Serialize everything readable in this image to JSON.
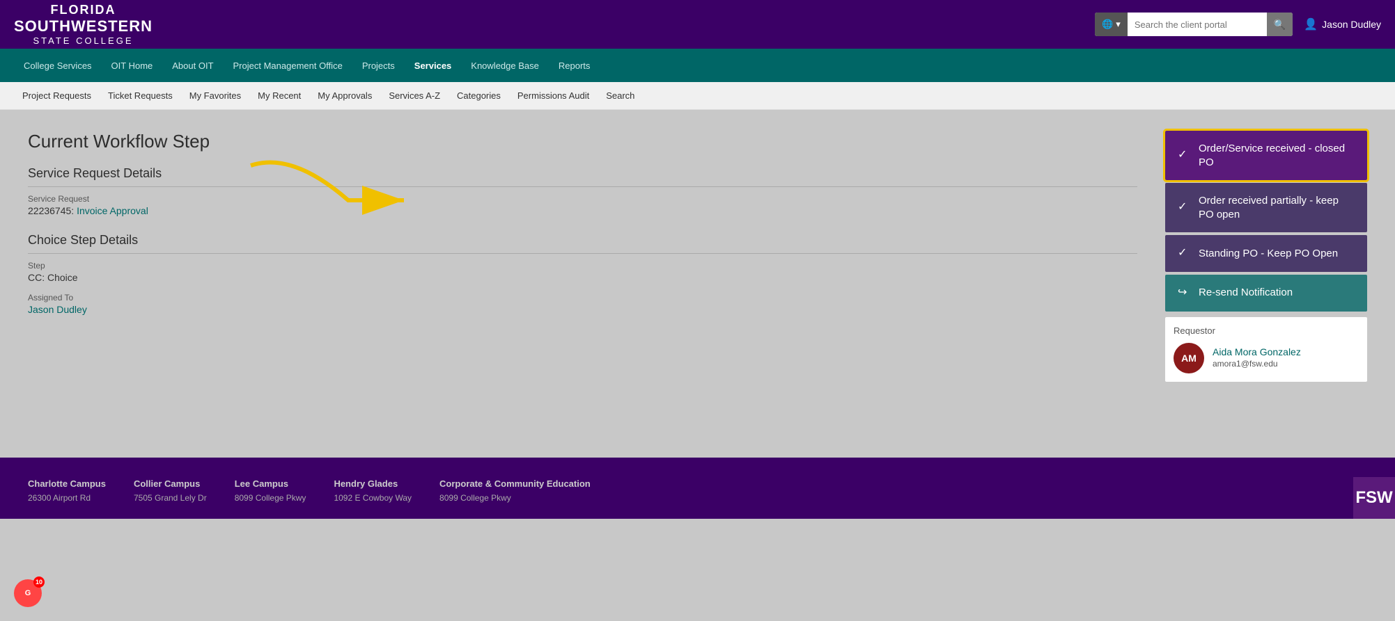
{
  "header": {
    "logo_line1": "FLORIDA",
    "logo_line2": "SOUTHWESTERN",
    "logo_line3": "STATE COLLEGE",
    "search_placeholder": "Search the client portal",
    "user_name": "Jason Dudley"
  },
  "main_nav": {
    "items": [
      {
        "label": "College Services",
        "active": false
      },
      {
        "label": "OIT Home",
        "active": false
      },
      {
        "label": "About OIT",
        "active": false
      },
      {
        "label": "Project Management Office",
        "active": false
      },
      {
        "label": "Projects",
        "active": false
      },
      {
        "label": "Services",
        "active": true
      },
      {
        "label": "Knowledge Base",
        "active": false
      },
      {
        "label": "Reports",
        "active": false
      }
    ]
  },
  "sub_nav": {
    "items": [
      {
        "label": "Project Requests"
      },
      {
        "label": "Ticket Requests"
      },
      {
        "label": "My Favorites"
      },
      {
        "label": "My Recent"
      },
      {
        "label": "My Approvals"
      },
      {
        "label": "Services A-Z"
      },
      {
        "label": "Categories"
      },
      {
        "label": "Permissions Audit"
      },
      {
        "label": "Search"
      }
    ]
  },
  "main": {
    "page_title": "Current Workflow Step",
    "service_request_subtitle": "Service Request Details",
    "service_request_label": "Service Request",
    "service_request_value": "22236745:",
    "service_request_link": "Invoice Approval",
    "choice_step_subtitle": "Choice Step Details",
    "step_label": "Step",
    "step_value": "CC: Choice",
    "assigned_to_label": "Assigned To",
    "assigned_to_link": "Jason Dudley"
  },
  "workflow": {
    "btn1_label": "Order/Service received - closed PO",
    "btn2_label": "Order received partially - keep PO open",
    "btn3_label": "Standing PO - Keep PO Open",
    "btn4_label": "Re-send Notification",
    "requestor_label": "Requestor",
    "requestor_name": "Aida Mora Gonzalez",
    "requestor_email": "amora1@fsw.edu",
    "requestor_initials": "AM"
  },
  "footer": {
    "col1_title": "Charlotte Campus",
    "col1_addr1": "26300 Airport Rd",
    "col2_title": "Collier Campus",
    "col2_addr1": "7505 Grand Lely Dr",
    "col3_title": "Lee Campus",
    "col3_addr1": "8099 College Pkwy",
    "col4_title": "Hendry Glades",
    "col4_addr1": "1092 E Cowboy Way",
    "col5_title": "Corporate & Community Education",
    "col5_addr1": "8099 College Pkwy"
  },
  "grammarly": {
    "label": "G",
    "count": "10"
  }
}
